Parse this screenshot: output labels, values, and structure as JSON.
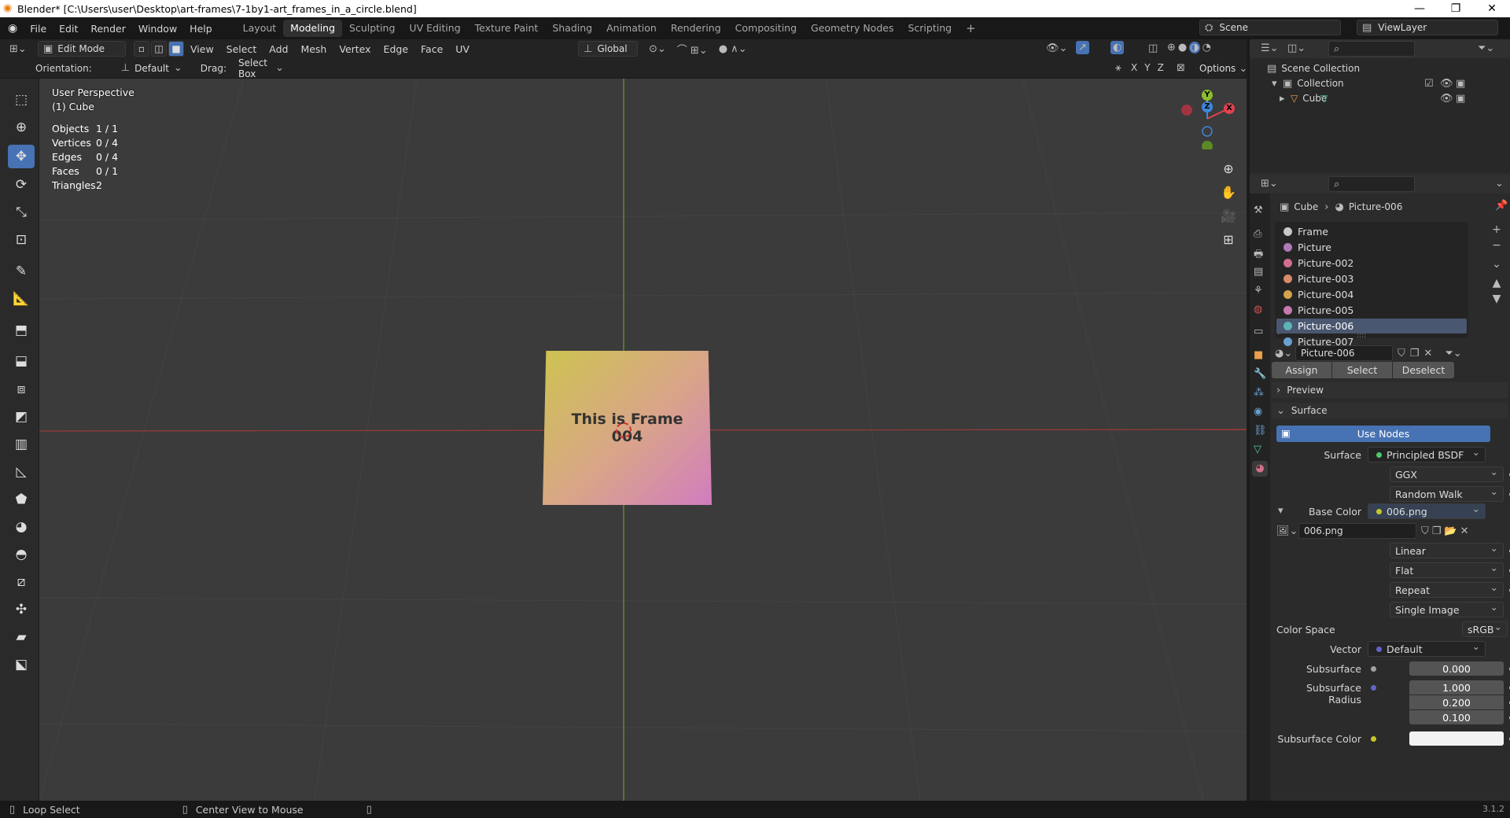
{
  "window": {
    "title": "Blender* [C:\\Users\\user\\Desktop\\art-frames\\7-1by1-art_frames_in_a_circle.blend]"
  },
  "menus": [
    "File",
    "Edit",
    "Render",
    "Window",
    "Help"
  ],
  "workspaces": [
    "Layout",
    "Modeling",
    "Sculpting",
    "UV Editing",
    "Texture Paint",
    "Shading",
    "Animation",
    "Rendering",
    "Compositing",
    "Geometry Nodes",
    "Scripting"
  ],
  "active_workspace": "Modeling",
  "scene": {
    "name": "Scene",
    "view_layer": "ViewLayer"
  },
  "header": {
    "mode": "Edit Mode",
    "menus": [
      "View",
      "Select",
      "Add",
      "Mesh",
      "Vertex",
      "Edge",
      "Face",
      "UV"
    ],
    "transform": "Global"
  },
  "toolsettings": {
    "orientation_label": "Orientation:",
    "orientation_value": "Default",
    "drag_label": "Drag:",
    "drag_value": "Select Box",
    "axes": [
      "X",
      "Y",
      "Z"
    ],
    "options": "Options"
  },
  "viewport": {
    "perspective": "User Perspective",
    "object": "(1) Cube",
    "stats": [
      {
        "label": "Objects",
        "value": "1 / 1"
      },
      {
        "label": "Vertices",
        "value": "0 / 4"
      },
      {
        "label": "Edges",
        "value": "0 / 4"
      },
      {
        "label": "Faces",
        "value": "0 / 1"
      },
      {
        "label": "Triangles",
        "value": "2"
      }
    ],
    "frame_text_line1": "This is Frame",
    "frame_text_line2": "004",
    "gizmo": {
      "x": "X",
      "y": "Y",
      "z": "Z"
    }
  },
  "outliner": {
    "root": "Scene Collection",
    "collection": "Collection",
    "object": "Cube"
  },
  "properties": {
    "breadcrumb": [
      "Cube",
      "Picture-006"
    ],
    "materials": [
      {
        "name": "Frame",
        "color": "#c8c8c8"
      },
      {
        "name": "Picture",
        "color": "#b07ab8"
      },
      {
        "name": "Picture-002",
        "color": "#d26f8c"
      },
      {
        "name": "Picture-003",
        "color": "#d88a6a"
      },
      {
        "name": "Picture-004",
        "color": "#d4a24a"
      },
      {
        "name": "Picture-005",
        "color": "#c77ab0"
      },
      {
        "name": "Picture-006",
        "color": "#5fb3b8"
      },
      {
        "name": "Picture-007",
        "color": "#6aa0d0"
      }
    ],
    "selected_material": "Picture-006",
    "material_name": "Picture-006",
    "buttons": {
      "assign": "Assign",
      "select": "Select",
      "deselect": "Deselect"
    },
    "panels": {
      "preview": "Preview",
      "surface": "Surface"
    },
    "use_nodes": "Use Nodes",
    "surface_label": "Surface",
    "surface_value": "Principled BSDF",
    "distribution": "GGX",
    "subsurface_method": "Random Walk",
    "base_color_label": "Base Color",
    "base_color_value": "006.png",
    "image_name": "006.png",
    "interpolation": "Linear",
    "projection": "Flat",
    "extension": "Repeat",
    "source": "Single Image",
    "color_space_label": "Color Space",
    "color_space_value": "sRGB",
    "vector_label": "Vector",
    "vector_value": "Default",
    "subsurface_label": "Subsurface",
    "subsurface_value": "0.000",
    "subsurface_radius_label": "Subsurface Radius",
    "subsurface_radius": [
      "1.000",
      "0.200",
      "0.100"
    ],
    "subsurface_color_label": "Subsurface Color"
  },
  "statusbar": {
    "left": "Loop Select",
    "middle": "Center View to Mouse",
    "version": "3.1.2"
  }
}
